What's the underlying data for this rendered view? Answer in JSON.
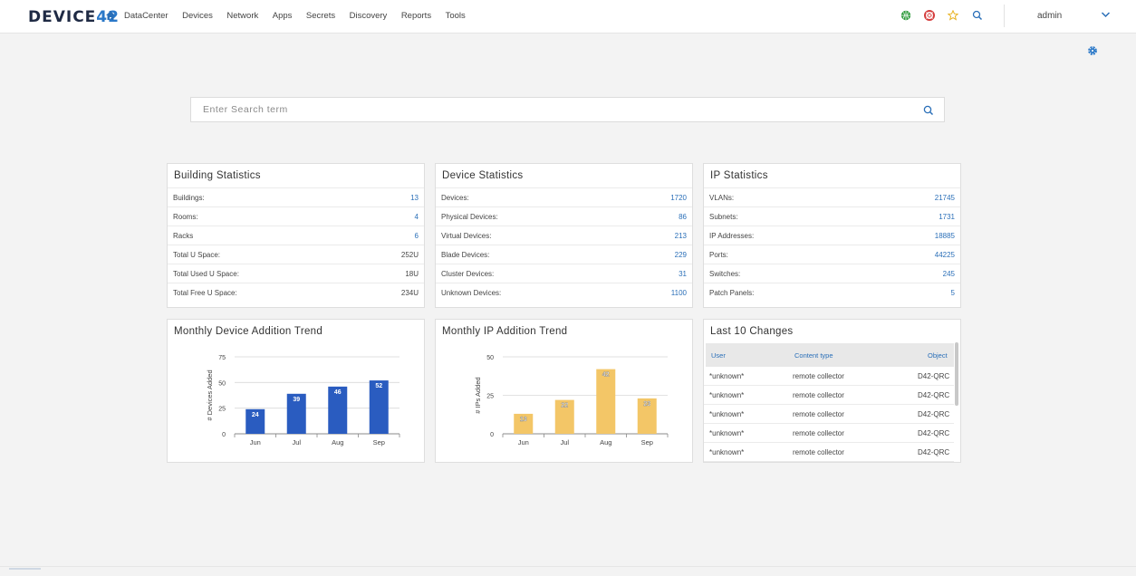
{
  "nav": {
    "logo_main": "DEVICE",
    "logo_num": "42",
    "items": [
      "DataCenter",
      "Devices",
      "Network",
      "Apps",
      "Secrets",
      "Discovery",
      "Reports",
      "Tools"
    ],
    "user": "admin",
    "icons": [
      "home-icon",
      "globe-icon",
      "help-ring-icon",
      "star-icon",
      "search-icon",
      "chevron-down-icon",
      "gear-icon"
    ]
  },
  "search": {
    "placeholder": "Enter Search term"
  },
  "building": {
    "title": "Building Statistics",
    "rows": [
      {
        "label": "Buildings:",
        "value": "13"
      },
      {
        "label": "Rooms:",
        "value": "4"
      },
      {
        "label": "Racks",
        "value": "6"
      },
      {
        "label": "Total U Space:",
        "value": "252U"
      },
      {
        "label": "Total Used U Space:",
        "value": "18U"
      },
      {
        "label": "Total Free U Space:",
        "value": "234U"
      }
    ]
  },
  "device": {
    "title": "Device Statistics",
    "rows": [
      {
        "label": "Devices:",
        "value": "1720"
      },
      {
        "label": "Physical Devices:",
        "value": "86"
      },
      {
        "label": "Virtual Devices:",
        "value": "213"
      },
      {
        "label": "Blade Devices:",
        "value": "229"
      },
      {
        "label": "Cluster Devices:",
        "value": "31"
      },
      {
        "label": "Unknown Devices:",
        "value": "1100"
      }
    ]
  },
  "ip": {
    "title": "IP Statistics",
    "rows": [
      {
        "label": "VLANs:",
        "value": "21745"
      },
      {
        "label": "Subnets:",
        "value": "1731"
      },
      {
        "label": "IP Addresses:",
        "value": "18885"
      },
      {
        "label": "Ports:",
        "value": "44225"
      },
      {
        "label": "Switches:",
        "value": "245"
      },
      {
        "label": "Patch Panels:",
        "value": "5"
      }
    ]
  },
  "changes": {
    "title": "Last 10 Changes",
    "headers": [
      "User",
      "Content type",
      "Object"
    ],
    "rows": [
      [
        "*unknown*",
        "remote collector",
        "D42-QRC"
      ],
      [
        "*unknown*",
        "remote collector",
        "D42-QRC"
      ],
      [
        "*unknown*",
        "remote collector",
        "D42-QRC"
      ],
      [
        "*unknown*",
        "remote collector",
        "D42-QRC"
      ],
      [
        "*unknown*",
        "remote collector",
        "D42-QRC"
      ]
    ]
  },
  "colors": {
    "accent": "#2a6fb8",
    "device_bar": "#2a5cc0",
    "ip_bar": "#f3c667"
  },
  "chart_data": [
    {
      "type": "bar",
      "title": "Monthly Device Addition Trend",
      "categories": [
        "Jun",
        "Jul",
        "Aug",
        "Sep"
      ],
      "values": [
        24,
        39,
        46,
        52
      ],
      "xlabel": "",
      "ylabel": "# Devices Added",
      "ylim": [
        0,
        75
      ],
      "yticks": [
        0,
        25,
        50,
        75
      ],
      "grid": true
    },
    {
      "type": "bar",
      "title": "Monthly IP Addition Trend",
      "categories": [
        "Jun",
        "Jul",
        "Aug",
        "Sep"
      ],
      "values": [
        13,
        22,
        42,
        23
      ],
      "xlabel": "",
      "ylabel": "# IPs Added",
      "ylim": [
        0,
        50
      ],
      "yticks": [
        0,
        25,
        50
      ],
      "grid": true
    }
  ]
}
